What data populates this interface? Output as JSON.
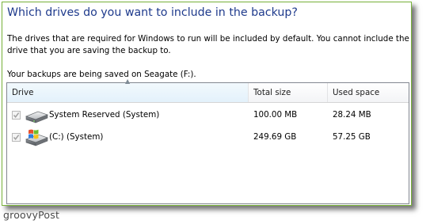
{
  "dialog": {
    "heading": "Which drives do you want to include in the backup?",
    "description": "The drives that are required for Windows to run will be included by default. You cannot include the drive that you are saving the backup to.",
    "saved_location": "Your backups are being saved on Seagate (F:)."
  },
  "drive_list": {
    "columns": {
      "drive": "Drive",
      "total_size": "Total size",
      "used_space": "Used space"
    },
    "sort_indicator": "▲",
    "rows": [
      {
        "name": "System Reserved (System)",
        "total_size": "100.00 MB",
        "used_space": "28.24 MB",
        "checked": true,
        "enabled": false,
        "icon": "hard-drive-icon"
      },
      {
        "name": "(C:) (System)",
        "total_size": "249.69 GB",
        "used_space": "57.25 GB",
        "checked": true,
        "enabled": false,
        "icon": "windows-drive-icon"
      }
    ]
  },
  "watermark": "groovyPost",
  "colors": {
    "heading": "#1e3a8c",
    "frame": "#78b33a",
    "list_border": "#828790"
  }
}
